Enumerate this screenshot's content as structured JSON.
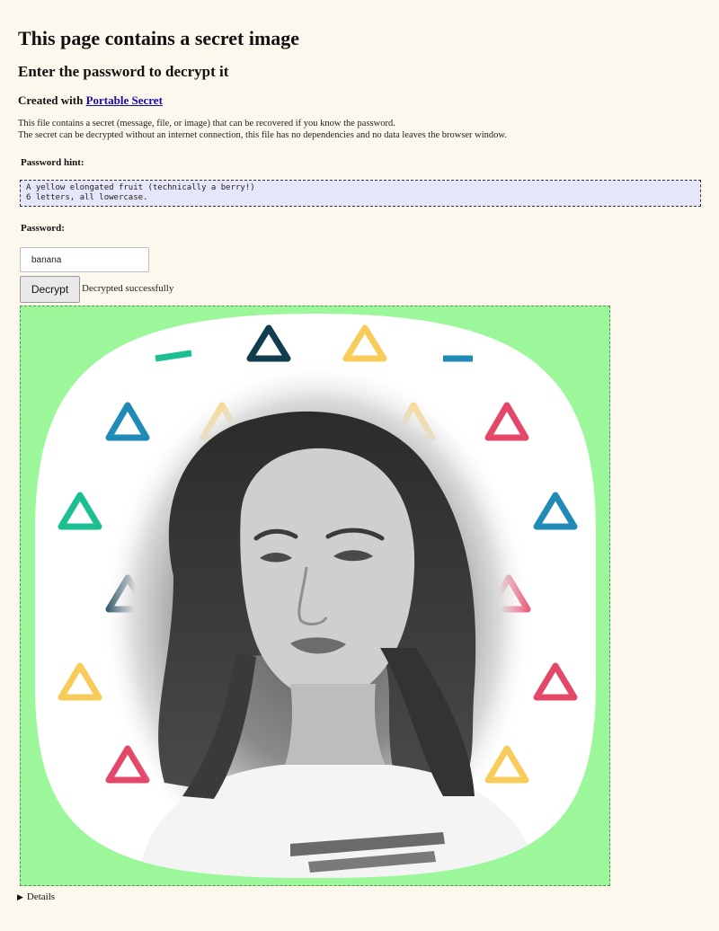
{
  "header": {
    "title": "This page contains a secret image",
    "subtitle": "Enter the password to decrypt it",
    "created_prefix": "Created with ",
    "created_link": "Portable Secret"
  },
  "description": {
    "line1": "This file contains a secret (message, file, or image) that can be recovered if you know the password.",
    "line2": "The secret can be decrypted without an internet connection, this file has no dependencies and no data leaves the browser window."
  },
  "hint": {
    "label": "Password hint:",
    "line1": "A yellow elongated fruit (technically a berry!)",
    "line2": "6 letters, all lowercase."
  },
  "password": {
    "label": "Password:",
    "value": "banana"
  },
  "decrypt": {
    "button_label": "Decrypt",
    "status": "Decrypted successfully"
  },
  "secret_image": {
    "frame_color": "#9cf79a",
    "background_color": "#ffffff",
    "triangle_colors": [
      "#1cbf91",
      "#123d4f",
      "#f8cc5a",
      "#1f8bb6",
      "#e54769"
    ],
    "portrait": "grayscale-portrait-woman"
  },
  "details": {
    "label": "Details"
  }
}
